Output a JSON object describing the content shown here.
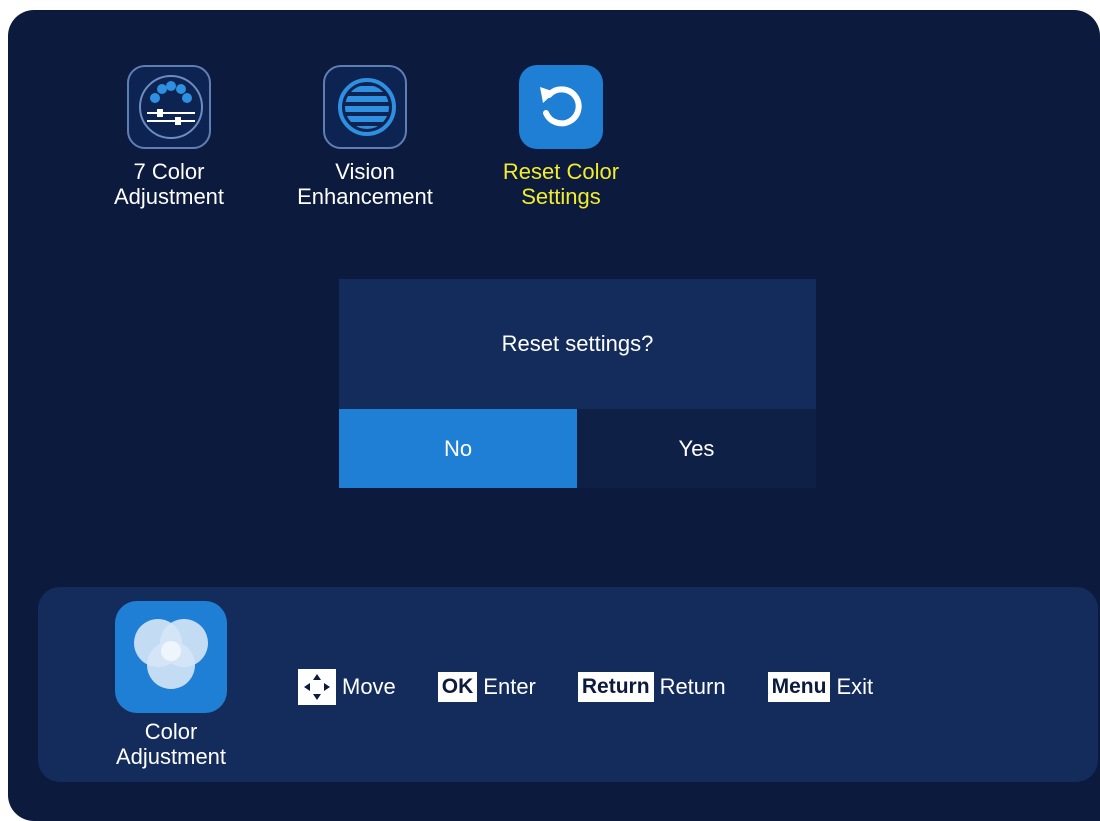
{
  "menu": {
    "items": [
      {
        "line1": "7 Color",
        "line2": "Adjustment",
        "icon": "color-dots-slider-icon"
      },
      {
        "line1": "Vision",
        "line2": "Enhancement",
        "icon": "stripes-circle-icon"
      },
      {
        "line1": "Reset Color",
        "line2": "Settings",
        "icon": "reset-arrow-icon",
        "active": true
      }
    ]
  },
  "dialog": {
    "message": "Reset settings?",
    "no_label": "No",
    "yes_label": "Yes"
  },
  "bottom": {
    "category": {
      "line1": "Color",
      "line2": "Adjustment",
      "icon": "color-circles-icon"
    },
    "hints": [
      {
        "key": "",
        "key_icon": "dpad-icon",
        "label": "Move"
      },
      {
        "key": "OK",
        "label": "Enter"
      },
      {
        "key": "Return",
        "label": "Return"
      },
      {
        "key": "Menu",
        "label": "Exit"
      }
    ]
  },
  "colors": {
    "background": "#0b1a3d",
    "panel": "#142c5c",
    "accent": "#1e7fd4",
    "active_text": "#f2ec2c"
  }
}
